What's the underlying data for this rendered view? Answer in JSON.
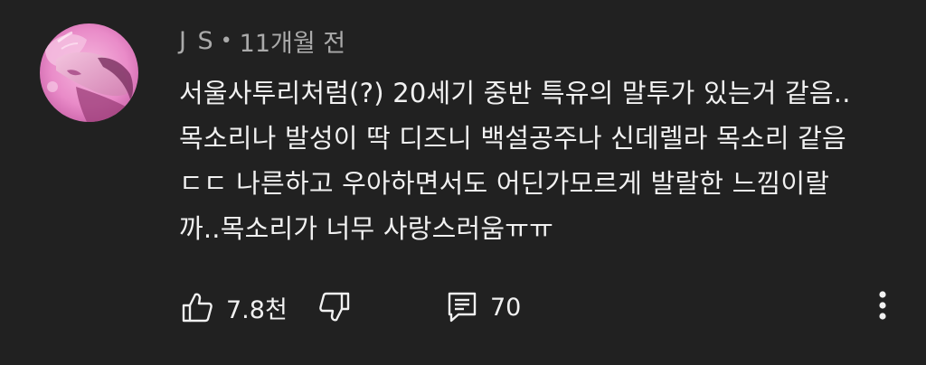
{
  "comment": {
    "author": "J S",
    "separator": "•",
    "time": "11개월 전",
    "lines": [
      "서울사투리처럼(?) 20세기 중반 특유의 말투가 있는거 같음..",
      "목소리나 발성이 딱 디즈니 백설공주나 신데렐라 목소리 같음",
      "ㄷㄷ 나른하고 우아하면서도 어딘가모르게 발랄한 느낌이랄",
      "까..목소리가 너무 사랑스러움ㅠㅠ"
    ],
    "avatar_icon": "profile-photo",
    "likes": "7.8천",
    "replies": "70"
  },
  "colors": {
    "background": "#212121",
    "text_primary": "#f1f1f1",
    "text_secondary": "#aaaaaa"
  },
  "icons": {
    "like": "thumbs-up-icon",
    "dislike": "thumbs-down-icon",
    "reply": "comment-icon",
    "more": "more-vertical-icon"
  }
}
